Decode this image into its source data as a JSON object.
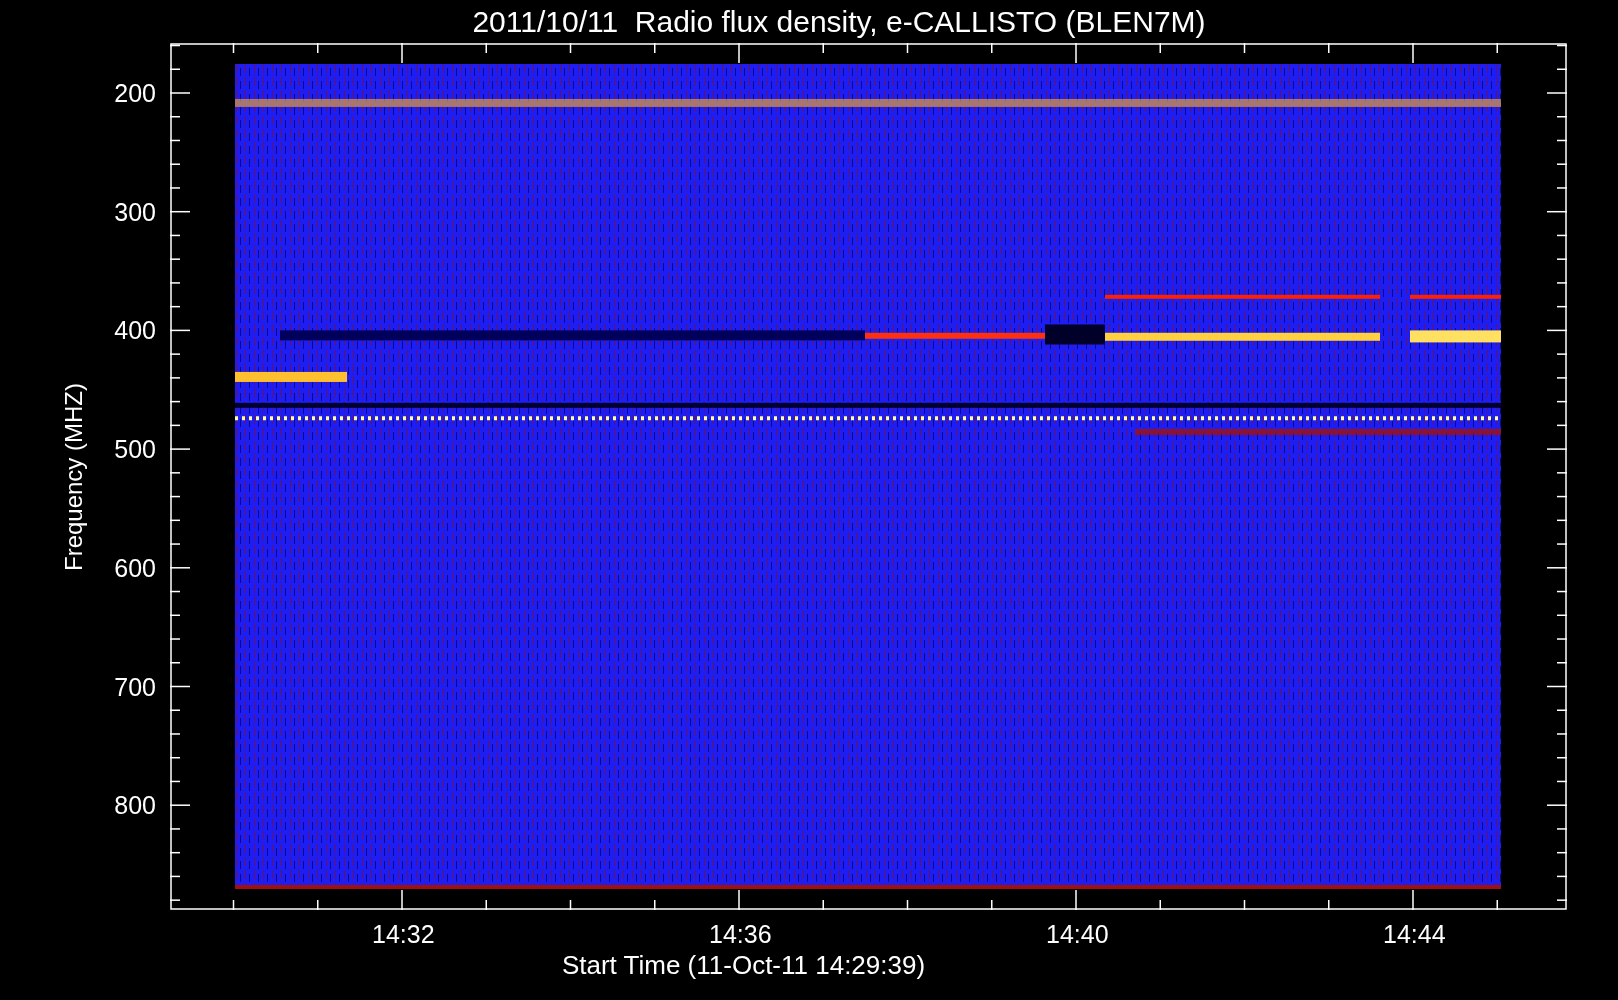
{
  "title": "2011/10/11  Radio flux density, e-CALLISTO (BLEN7M)",
  "y_axis": {
    "label": "Frequency (MHZ)",
    "ticks": [
      "200",
      "300",
      "400",
      "500",
      "600",
      "700",
      "800"
    ]
  },
  "x_axis": {
    "label": "Start Time (11-Oct-11 14:29:39)",
    "ticks": [
      "14:32",
      "14:36",
      "14:40",
      "14:44"
    ]
  }
}
